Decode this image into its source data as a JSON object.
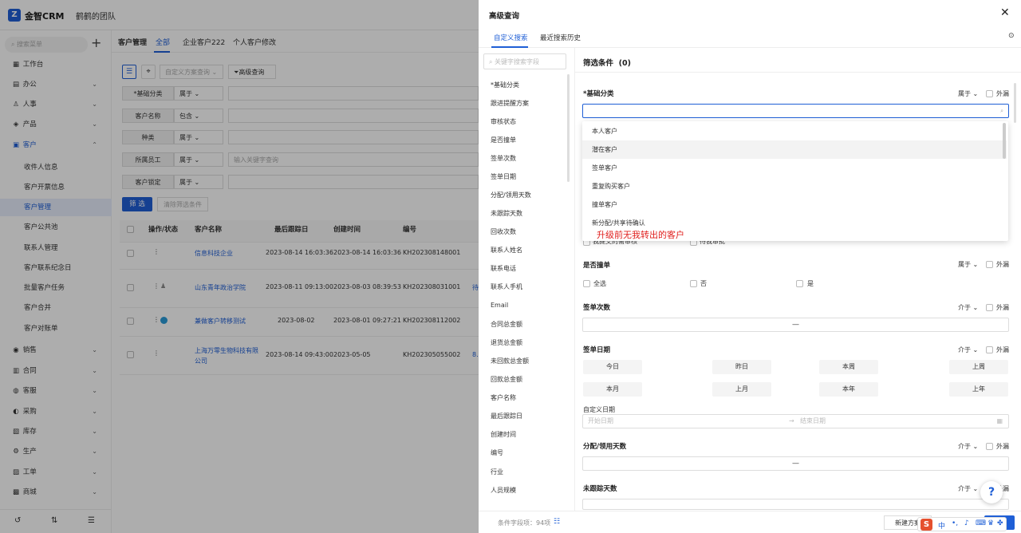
{
  "app": {
    "logo": "金智CRM",
    "team": "鹤鹤的团队"
  },
  "sidebar": {
    "search_placeholder": "搜索菜单",
    "items": [
      "工作台",
      "办公",
      "人事",
      "产品",
      "客户",
      "收件人信息",
      "客户开票信息",
      "客户管理",
      "客户公共池",
      "联系人管理",
      "客户联系纪念日",
      "批量客户任务",
      "客户合并",
      "客户对账单",
      "销售",
      "合同",
      "客服",
      "采购",
      "库存",
      "生产",
      "工单",
      "商城"
    ]
  },
  "main": {
    "module": "客户管理",
    "tabs": [
      "全部",
      "企业客户222",
      "个人客户修改"
    ],
    "filter_select_placeholder": "自定义方案查询",
    "advanced_button": "高级查询",
    "filters": [
      {
        "label": "*基础分类",
        "op": "属于",
        "value": ""
      },
      {
        "label": "客户名称",
        "op": "包含",
        "value": ""
      },
      {
        "label": "种类",
        "op": "属于",
        "value": ""
      },
      {
        "label": "所属员工",
        "op": "属于",
        "value": "",
        "placeholder": "输入关键字查询"
      },
      {
        "label": "客户锁定",
        "op": "属于",
        "value": ""
      }
    ],
    "filter_button": "筛 选",
    "clear_button": "清除筛选条件",
    "table": {
      "headers": [
        "操作/状态",
        "客户名称",
        "最后跟踪日",
        "创建时间",
        "编号"
      ],
      "rows": [
        {
          "name": "信息科技企业",
          "last": "2023-08-14 16:03:36",
          "created": "2023-08-14 16:03:36",
          "code": "KH202308148001",
          "extra": ""
        },
        {
          "name": "山东青年政治学院",
          "last": "2023-08-11 09:13:00",
          "created": "2023-08-03 08:39:53",
          "code": "KH202308031001",
          "extra": "待"
        },
        {
          "name": "兼做客户转移测试",
          "last": "2023-08-02",
          "created": "2023-08-01 09:27:21",
          "code": "KH202308112002",
          "extra": ""
        },
        {
          "name": "上海万零生物科技有限公司",
          "last": "2023-08-14 09:43:00",
          "created": "2023-05-05",
          "code": "KH202305055002",
          "extra": "8."
        }
      ]
    }
  },
  "drawer": {
    "title": "高级查询",
    "tabs": [
      "自定义搜索",
      "最近搜索历史"
    ],
    "field_search_placeholder": "关键字搜索字段",
    "fields": [
      "*基础分类",
      "跟进提醒方案",
      "审核状态",
      "是否撞单",
      "签单次数",
      "签单日期",
      "分配/领用天数",
      "未跟踪天数",
      "回收次数",
      "联系人姓名",
      "联系电话",
      "联系人手机",
      "Email",
      "合同总金额",
      "退货总金额",
      "未回款总金额",
      "回款总金额",
      "客户名称",
      "最后跟踪日",
      "创建时间",
      "编号",
      "行业",
      "人员规模"
    ],
    "conditions_title": "筛选条件",
    "conditions_count": "(0)",
    "sections": {
      "s1": {
        "label": "*基础分类",
        "op": "属于",
        "ex": "外漏"
      },
      "s2": {
        "label": "是否撞单",
        "op": "属于",
        "ex": "外漏",
        "opts": [
          "全选",
          "否",
          "是"
        ]
      },
      "s3": {
        "label": "签单次数",
        "op": "介于",
        "ex": "外漏",
        "sep": "—"
      },
      "s4": {
        "label": "签单日期",
        "op": "介于",
        "ex": "外漏",
        "btns": [
          "今日",
          "昨日",
          "本周",
          "上周",
          "本月",
          "上月",
          "本年",
          "上年"
        ],
        "custom": "自定义日期",
        "start": "开始日期",
        "end": "结束日期"
      },
      "s5": {
        "label": "分配/领用天数",
        "op": "介于",
        "ex": "外漏",
        "sep": "—"
      },
      "s6": {
        "label": "未跟踪天数",
        "op": "介于",
        "ex": "外漏"
      }
    },
    "dropdown_options": [
      "本人客户",
      "潜在客户",
      "签单客户",
      "重复购买客户",
      "撞单客户",
      "新分配/共享待确认"
    ],
    "hidden_row": [
      "我提交的需审核",
      "待我审批"
    ],
    "annotation": "升级前无我转出的客户",
    "footer_count": "条件字段项：94项",
    "new_plan": "新建方案",
    "ime": "中"
  }
}
